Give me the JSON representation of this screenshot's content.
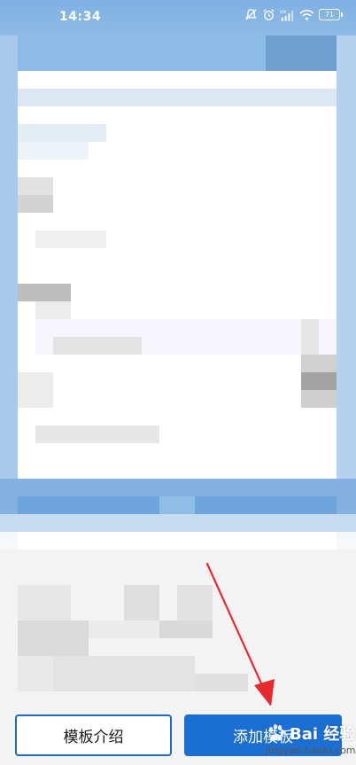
{
  "status_bar": {
    "time": "14:34",
    "battery": "71",
    "icons": [
      "mute-icon",
      "alarm-icon",
      "hd-signal-icon",
      "wifi-icon",
      "battery-icon"
    ]
  },
  "bottom_bar": {
    "intro_button": "模板介绍",
    "add_button": "添加模板"
  },
  "watermark": {
    "brand": "Bai 经验",
    "url": "jingyan.baidu.com"
  },
  "colors": {
    "primary": "#1b6fd2",
    "arrow": "#e8292e",
    "header_blue": "#7fb1e3"
  }
}
